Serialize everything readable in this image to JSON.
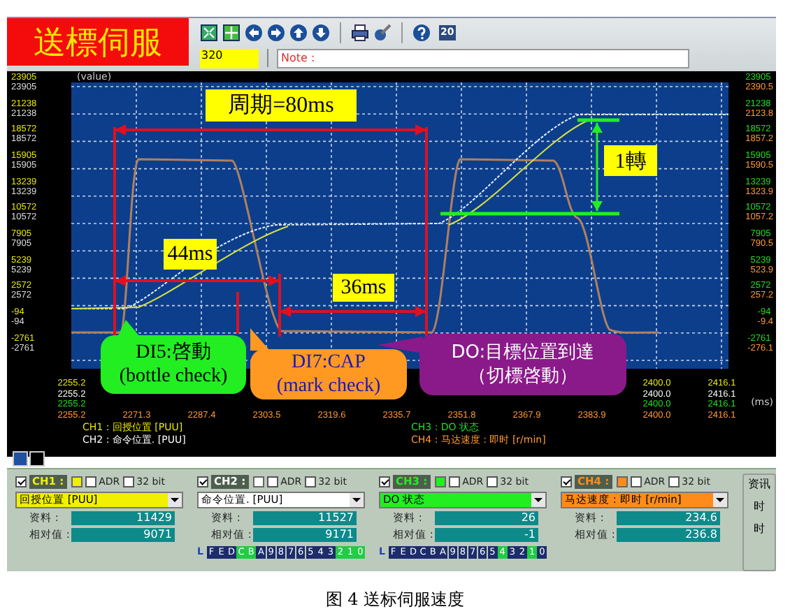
{
  "title": "送標伺服",
  "toolbar": {
    "icon_badge": "20",
    "sample_count": "320",
    "note_label": "Note :"
  },
  "scope": {
    "y_label": "(value)",
    "x_unit": "(ms)",
    "left_ticks": [
      {
        "a": "23905",
        "b": "23905"
      },
      {
        "a": "21238",
        "b": "21238"
      },
      {
        "a": "18572",
        "b": "18572"
      },
      {
        "a": "15905",
        "b": "15905"
      },
      {
        "a": "13239",
        "b": "13239"
      },
      {
        "a": "10572",
        "b": "10572"
      },
      {
        "a": "7905",
        "b": "7905"
      },
      {
        "a": "5239",
        "b": "5239"
      },
      {
        "a": "2572",
        "b": "2572"
      },
      {
        "a": "-94",
        "b": "-94"
      },
      {
        "a": "-2761",
        "b": "-2761"
      }
    ],
    "right_ticks": [
      {
        "a": "23905",
        "b": "2390.5"
      },
      {
        "a": "21238",
        "b": "2123.8"
      },
      {
        "a": "18572",
        "b": "1857.2"
      },
      {
        "a": "15905",
        "b": "1590.5"
      },
      {
        "a": "13239",
        "b": "1323.9"
      },
      {
        "a": "10572",
        "b": "1057.2"
      },
      {
        "a": "7905",
        "b": "790.5"
      },
      {
        "a": "5239",
        "b": "523.9"
      },
      {
        "a": "2572",
        "b": "257.2"
      },
      {
        "a": "-94",
        "b": "-9.4"
      },
      {
        "a": "-2761",
        "b": "-276.1"
      }
    ],
    "x_ticks": [
      {
        "labels": [
          {
            "text": "2255.2",
            "color": "#e8e800"
          },
          {
            "text": "2255.2",
            "color": "#ffffff"
          },
          {
            "text": "2255.2",
            "color": "#22dd22"
          },
          {
            "text": "2255.2",
            "color": "#ff9933"
          }
        ]
      },
      {
        "labels": [
          {
            "text": "2271.3",
            "color": "#ff9933"
          }
        ]
      },
      {
        "labels": [
          {
            "text": "2287.4",
            "color": "#ff9933"
          }
        ]
      },
      {
        "labels": [
          {
            "text": "2303.5",
            "color": "#ff9933"
          }
        ]
      },
      {
        "labels": [
          {
            "text": "2319.6",
            "color": "#ff9933"
          }
        ]
      },
      {
        "labels": [
          {
            "text": "2335.7",
            "color": "#ff9933"
          }
        ]
      },
      {
        "labels": [
          {
            "text": "2351.8",
            "color": "#ff9933"
          }
        ]
      },
      {
        "labels": [
          {
            "text": "2367.9",
            "color": "#ff9933"
          }
        ]
      },
      {
        "labels": [
          {
            "text": "2383.9",
            "color": "#ff9933"
          }
        ]
      },
      {
        "labels": [
          {
            "text": "2400.0",
            "color": "#e8e800"
          },
          {
            "text": "2400.0",
            "color": "#ffffff"
          },
          {
            "text": "2400.0",
            "color": "#22dd22"
          },
          {
            "text": "2400.0",
            "color": "#ff9933"
          }
        ]
      },
      {
        "labels": [
          {
            "text": "2416.1",
            "color": "#e8e800"
          },
          {
            "text": "2416.1",
            "color": "#ffffff"
          },
          {
            "text": "2416.1",
            "color": "#22dd22"
          },
          {
            "text": "2416.1",
            "color": "#ff9933"
          }
        ]
      }
    ],
    "legend": [
      {
        "text": "CH1 : 回授位置 [PUU]",
        "color": "#e8e800"
      },
      {
        "text": "CH2 : 命令位置. [PUU]",
        "color": "#ffffff"
      },
      {
        "text": "CH3 : DO 状态",
        "color": "#22dd22"
      },
      {
        "text": "CH4 : 马达速度 : 即时 [r/min]",
        "color": "#ff9933"
      }
    ],
    "annotations": {
      "period": "周期=80ms",
      "accel": "44ms",
      "decel": "36ms",
      "turn": "1轉",
      "bubbles": [
        {
          "kind": "green",
          "lines": [
            "DI5:啓動",
            "(bottle check)"
          ]
        },
        {
          "kind": "orange",
          "lines": [
            "DI7:CAP",
            "(mark check)"
          ]
        },
        {
          "kind": "purple",
          "lines": [
            "DO:目標位置到達",
            "（切標啓動）"
          ]
        }
      ]
    }
  },
  "channels": [
    {
      "name": "CH1 :",
      "color": "#f0f000",
      "enabled": true,
      "adr": false,
      "adr_label": "ADR",
      "bit32": false,
      "bit32_label": "32 bit",
      "source": "回授位置 [PUU]",
      "data_label": "资料 :",
      "data": "11429",
      "rel_label": "相对值 :",
      "rel": "9071"
    },
    {
      "name": "CH2 :",
      "color": "#ffffff",
      "enabled": true,
      "adr": false,
      "adr_label": "ADR",
      "bit32": false,
      "bit32_label": "32 bit",
      "source": "命令位置. [PUU]",
      "data_label": "资料 :",
      "data": "11527",
      "rel_label": "相对值 :",
      "rel": "9171",
      "bits": {
        "prefix": "L",
        "cells": [
          {
            "label": "F",
            "on": false
          },
          {
            "label": "E",
            "on": false
          },
          {
            "label": "D",
            "on": false
          },
          {
            "label": "C",
            "on": true
          },
          {
            "label": "B",
            "on": true
          },
          {
            "label": "A",
            "on": false
          },
          {
            "label": "9",
            "on": false
          },
          {
            "label": "8",
            "on": false
          },
          {
            "label": "7",
            "on": false
          },
          {
            "label": "6",
            "on": false
          },
          {
            "label": "5",
            "on": false
          },
          {
            "label": "4",
            "on": false
          },
          {
            "label": "3",
            "on": false
          },
          {
            "label": "2",
            "on": true
          },
          {
            "label": "1",
            "on": true
          },
          {
            "label": "0",
            "on": true
          }
        ]
      }
    },
    {
      "name": "CH3 :",
      "color": "#22ee22",
      "enabled": true,
      "adr": false,
      "adr_label": "ADR",
      "bit32": false,
      "bit32_label": "32 bit",
      "source": "DO 状态",
      "data_label": "资料 :",
      "data": "26",
      "rel_label": "相对值 :",
      "rel": "-1",
      "bits": {
        "prefix": "L",
        "cells": [
          {
            "label": "F",
            "on": false
          },
          {
            "label": "E",
            "on": false
          },
          {
            "label": "D",
            "on": false
          },
          {
            "label": "C",
            "on": false
          },
          {
            "label": "B",
            "on": false
          },
          {
            "label": "A",
            "on": false
          },
          {
            "label": "9",
            "on": false
          },
          {
            "label": "8",
            "on": false
          },
          {
            "label": "7",
            "on": false
          },
          {
            "label": "6",
            "on": false
          },
          {
            "label": "5",
            "on": false
          },
          {
            "label": "4",
            "on": true
          },
          {
            "label": "3",
            "on": false
          },
          {
            "label": "2",
            "on": false
          },
          {
            "label": "1",
            "on": true
          },
          {
            "label": "0",
            "on": false
          }
        ]
      }
    },
    {
      "name": "CH4 :",
      "color": "#ff8c1a",
      "enabled": true,
      "adr": false,
      "adr_label": "ADR",
      "bit32": false,
      "bit32_label": "32 bit",
      "source": "马达速度 : 即时 [r/min]",
      "data_label": "资料 :",
      "data": "234.6",
      "rel_label": "相对值 :",
      "rel": "236.8"
    }
  ],
  "info_panel": {
    "title": "资讯",
    "rows": [
      "时",
      "时"
    ]
  },
  "caption": "图 4 送标伺服速度"
}
